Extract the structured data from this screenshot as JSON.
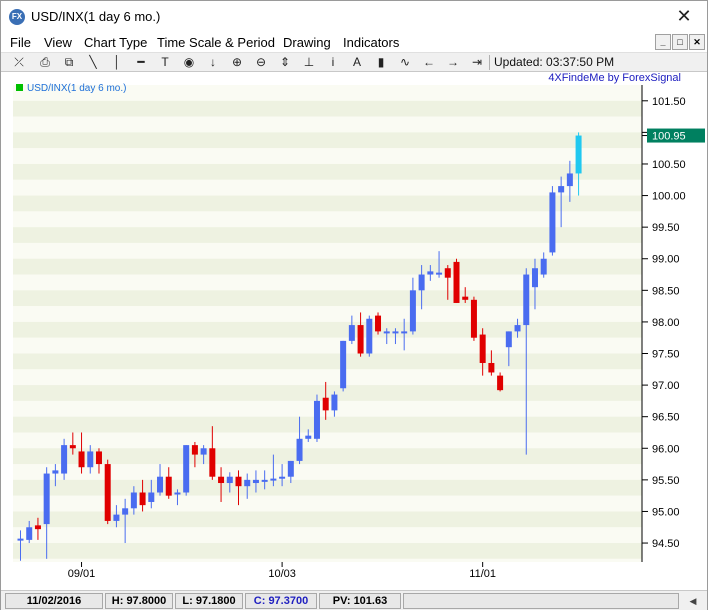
{
  "window": {
    "title": "USD/INX(1 day  6 mo.)",
    "icon": "forex-app-icon",
    "close_label": "✕"
  },
  "menu": {
    "items": [
      "File",
      "View",
      "Chart Type",
      "Time Scale & Period",
      "Drawing",
      "Indicators"
    ],
    "mdi_buttons": [
      "_",
      "□",
      "✕"
    ]
  },
  "toolbar": {
    "updated": "Updated: 03:37:50 PM",
    "tools": [
      {
        "name": "zoom-extent-icon",
        "glyph": "⤫"
      },
      {
        "name": "print-icon",
        "glyph": "⎙"
      },
      {
        "name": "copy-icon",
        "glyph": "⧉"
      },
      {
        "name": "trend-line-icon",
        "glyph": "╲"
      },
      {
        "name": "vertical-line-icon",
        "glyph": "│"
      },
      {
        "name": "horizontal-line-icon",
        "glyph": "━"
      },
      {
        "name": "text-tool-icon",
        "glyph": "T"
      },
      {
        "name": "target-icon",
        "glyph": "◉"
      },
      {
        "name": "arrow-down-icon",
        "glyph": "↓"
      },
      {
        "name": "zoom-in-icon",
        "glyph": "⊕"
      },
      {
        "name": "zoom-out-icon",
        "glyph": "⊖"
      },
      {
        "name": "fit-height-icon",
        "glyph": "⇕"
      },
      {
        "name": "baseline-icon",
        "glyph": "⊥"
      },
      {
        "name": "info-icon",
        "glyph": "i"
      },
      {
        "name": "text-a-icon",
        "glyph": "A"
      },
      {
        "name": "bar-chart-icon",
        "glyph": "▮"
      },
      {
        "name": "line-chart-icon",
        "glyph": "∿"
      },
      {
        "name": "scroll-left-icon",
        "glyph": "←"
      },
      {
        "name": "scroll-right-icon",
        "glyph": "→"
      },
      {
        "name": "scroll-end-icon",
        "glyph": "⇥"
      }
    ]
  },
  "colors": {
    "bull": "#4a6cf0",
    "bear": "#e00000",
    "last": "#20c8f0",
    "band_light": "#fafbf3",
    "band_dark": "#eef2e1",
    "price_tag": "#008060",
    "legend_box": "#00c000",
    "legend_text": "#1e6fd9",
    "brand_text": "#2020c0"
  },
  "chart": {
    "legend": "USD/INX(1 day  6 mo.)",
    "brand": "4XFindeMe by ForexSignal",
    "last_price": "100.95",
    "y_ticks": [
      "101.50",
      "101.00",
      "100.50",
      "100.00",
      "99.50",
      "99.00",
      "98.50",
      "98.00",
      "97.50",
      "97.00",
      "96.50",
      "96.00",
      "95.50",
      "95.00",
      "94.50"
    ],
    "x_labels": [
      {
        "label": "09/01",
        "bar": 7
      },
      {
        "label": "10/03",
        "bar": 30
      },
      {
        "label": "11/01",
        "bar": 53
      }
    ]
  },
  "chart_data": {
    "type": "candlestick",
    "ylim": [
      94.2,
      101.75
    ],
    "last_price": 100.95,
    "candles": [
      {
        "o": 94.55,
        "h": 94.7,
        "l": 94.22,
        "c": 94.57
      },
      {
        "o": 94.55,
        "h": 94.85,
        "l": 94.5,
        "c": 94.75
      },
      {
        "o": 94.78,
        "h": 94.9,
        "l": 94.55,
        "c": 94.72
      },
      {
        "o": 94.8,
        "h": 95.7,
        "l": 94.25,
        "c": 95.6
      },
      {
        "o": 95.6,
        "h": 95.75,
        "l": 95.4,
        "c": 95.65
      },
      {
        "o": 95.6,
        "h": 96.15,
        "l": 95.5,
        "c": 96.05
      },
      {
        "o": 96.05,
        "h": 96.25,
        "l": 95.9,
        "c": 96.0
      },
      {
        "o": 95.95,
        "h": 96.25,
        "l": 95.6,
        "c": 95.7
      },
      {
        "o": 95.7,
        "h": 96.05,
        "l": 95.6,
        "c": 95.95
      },
      {
        "o": 95.95,
        "h": 96.0,
        "l": 95.6,
        "c": 95.75
      },
      {
        "o": 95.75,
        "h": 95.82,
        "l": 94.8,
        "c": 94.85
      },
      {
        "o": 94.85,
        "h": 95.1,
        "l": 94.75,
        "c": 94.95
      },
      {
        "o": 94.95,
        "h": 95.2,
        "l": 94.5,
        "c": 95.05
      },
      {
        "o": 95.05,
        "h": 95.4,
        "l": 94.95,
        "c": 95.3
      },
      {
        "o": 95.3,
        "h": 95.5,
        "l": 95.0,
        "c": 95.1
      },
      {
        "o": 95.15,
        "h": 95.5,
        "l": 95.05,
        "c": 95.3
      },
      {
        "o": 95.3,
        "h": 95.75,
        "l": 95.25,
        "c": 95.55
      },
      {
        "o": 95.55,
        "h": 95.7,
        "l": 95.2,
        "c": 95.25
      },
      {
        "o": 95.3,
        "h": 95.35,
        "l": 95.1,
        "c": 95.3
      },
      {
        "o": 95.3,
        "h": 96.05,
        "l": 95.25,
        "c": 96.05
      },
      {
        "o": 96.05,
        "h": 96.1,
        "l": 95.7,
        "c": 95.9
      },
      {
        "o": 95.9,
        "h": 96.05,
        "l": 95.75,
        "c": 96.0
      },
      {
        "o": 96.0,
        "h": 96.35,
        "l": 95.5,
        "c": 95.55
      },
      {
        "o": 95.55,
        "h": 95.7,
        "l": 95.15,
        "c": 95.45
      },
      {
        "o": 95.45,
        "h": 95.62,
        "l": 95.3,
        "c": 95.55
      },
      {
        "o": 95.55,
        "h": 95.65,
        "l": 95.1,
        "c": 95.4
      },
      {
        "o": 95.4,
        "h": 95.6,
        "l": 95.2,
        "c": 95.5
      },
      {
        "o": 95.45,
        "h": 95.65,
        "l": 95.3,
        "c": 95.5
      },
      {
        "o": 95.5,
        "h": 95.65,
        "l": 95.35,
        "c": 95.5
      },
      {
        "o": 95.5,
        "h": 95.9,
        "l": 95.4,
        "c": 95.52
      },
      {
        "o": 95.55,
        "h": 95.75,
        "l": 95.4,
        "c": 95.55
      },
      {
        "o": 95.55,
        "h": 95.8,
        "l": 95.45,
        "c": 95.8
      },
      {
        "o": 95.8,
        "h": 96.5,
        "l": 95.75,
        "c": 96.15
      },
      {
        "o": 96.15,
        "h": 96.3,
        "l": 96.1,
        "c": 96.2
      },
      {
        "o": 96.15,
        "h": 96.85,
        "l": 96.1,
        "c": 96.75
      },
      {
        "o": 96.8,
        "h": 97.05,
        "l": 96.45,
        "c": 96.6
      },
      {
        "o": 96.6,
        "h": 96.9,
        "l": 96.5,
        "c": 96.85
      },
      {
        "o": 96.95,
        "h": 97.7,
        "l": 96.9,
        "c": 97.7
      },
      {
        "o": 97.7,
        "h": 98.1,
        "l": 97.65,
        "c": 97.95
      },
      {
        "o": 97.95,
        "h": 98.15,
        "l": 97.45,
        "c": 97.5
      },
      {
        "o": 97.5,
        "h": 98.1,
        "l": 97.45,
        "c": 98.05
      },
      {
        "o": 98.1,
        "h": 98.15,
        "l": 97.8,
        "c": 97.85
      },
      {
        "o": 97.85,
        "h": 97.9,
        "l": 97.65,
        "c": 97.85
      },
      {
        "o": 97.85,
        "h": 97.9,
        "l": 97.65,
        "c": 97.85
      },
      {
        "o": 97.85,
        "h": 98.05,
        "l": 97.55,
        "c": 97.85
      },
      {
        "o": 97.85,
        "h": 98.7,
        "l": 97.8,
        "c": 98.5
      },
      {
        "o": 98.5,
        "h": 98.9,
        "l": 98.2,
        "c": 98.75
      },
      {
        "o": 98.75,
        "h": 98.9,
        "l": 98.65,
        "c": 98.8
      },
      {
        "o": 98.75,
        "h": 99.12,
        "l": 98.7,
        "c": 98.78
      },
      {
        "o": 98.85,
        "h": 98.9,
        "l": 98.35,
        "c": 98.7
      },
      {
        "o": 98.95,
        "h": 99.0,
        "l": 98.3,
        "c": 98.3
      },
      {
        "o": 98.4,
        "h": 98.55,
        "l": 98.3,
        "c": 98.35
      },
      {
        "o": 98.35,
        "h": 98.4,
        "l": 97.7,
        "c": 97.75
      },
      {
        "o": 97.8,
        "h": 97.9,
        "l": 97.15,
        "c": 97.35
      },
      {
        "o": 97.35,
        "h": 97.55,
        "l": 97.15,
        "c": 97.2
      },
      {
        "o": 97.15,
        "h": 97.2,
        "l": 96.9,
        "c": 96.92
      },
      {
        "o": 97.6,
        "h": 97.85,
        "l": 97.3,
        "c": 97.85
      },
      {
        "o": 97.85,
        "h": 98.05,
        "l": 97.75,
        "c": 97.95
      },
      {
        "o": 97.95,
        "h": 98.85,
        "l": 95.9,
        "c": 98.75
      },
      {
        "o": 98.55,
        "h": 99.0,
        "l": 98.2,
        "c": 98.85
      },
      {
        "o": 98.75,
        "h": 99.1,
        "l": 98.7,
        "c": 99.0
      },
      {
        "o": 99.1,
        "h": 100.15,
        "l": 99.05,
        "c": 100.05
      },
      {
        "o": 100.05,
        "h": 100.3,
        "l": 99.5,
        "c": 100.15
      },
      {
        "o": 100.15,
        "h": 100.55,
        "l": 99.9,
        "c": 100.35
      },
      {
        "o": 100.35,
        "h": 101.0,
        "l": 100.0,
        "c": 100.95
      }
    ]
  },
  "status": {
    "date": "11/02/2016",
    "high": "H: 97.8000",
    "low": "L: 97.1800",
    "close": "C: 97.3700",
    "pv": "PV: 101.63",
    "scroll": "◀"
  }
}
